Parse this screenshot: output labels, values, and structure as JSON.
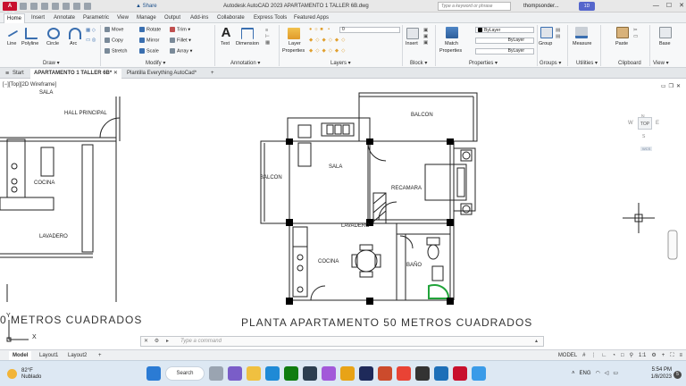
{
  "titlebar": {
    "app_badge": "A CAD",
    "share": "Share",
    "title": "Autodesk AutoCAD 2023    APARTAMENTO 1 TALLER 6B.dwg",
    "search_placeholder": "Type a keyword or phrase",
    "user": "thompsonder...",
    "badge": "1D",
    "min": "—",
    "max": "☐",
    "close": "✕"
  },
  "ribbon_tabs": [
    "Home",
    "Insert",
    "Annotate",
    "Parametric",
    "View",
    "Manage",
    "Output",
    "Add-ins",
    "Collaborate",
    "Express Tools",
    "Featured Apps"
  ],
  "ribbon": {
    "draw": {
      "line": "Line",
      "polyline": "Polyline",
      "circle": "Circle",
      "arc": "Arc",
      "label": "Draw"
    },
    "modify": {
      "move": "Move",
      "rotate": "Rotate",
      "trim": "Trim",
      "copy": "Copy",
      "mirror": "Mirror",
      "fillet": "Fillet",
      "stretch": "Stretch",
      "scale": "Scale",
      "array": "Array",
      "label": "Modify"
    },
    "annotation": {
      "text": "Text",
      "dimension": "Dimension",
      "label": "Annotation"
    },
    "layers": {
      "layer_properties_1": "Layer",
      "layer_properties_2": "Properties",
      "current_layer": "0",
      "label": "Layers"
    },
    "block": {
      "insert": "Insert",
      "label": "Block"
    },
    "properties": {
      "match_1": "Match",
      "match_2": "Properties",
      "color": "ByLayer",
      "linetype": "ByLayer",
      "lineweight": "ByLayer",
      "label": "Properties"
    },
    "groups": {
      "group": "Group",
      "label": "Groups"
    },
    "utilities": {
      "measure": "Measure",
      "label": "Utilities"
    },
    "clipboard": {
      "paste": "Paste",
      "label": "Clipboard"
    },
    "view": {
      "base": "Base",
      "label": "View"
    }
  },
  "doc_tabs": [
    "Start",
    "APARTAMENTO 1 TALLER 6B*",
    "Plantilla Everything AutoCad*"
  ],
  "viewport": {
    "label": "[−][Top][2D Wireframe]",
    "compass": {
      "n": "N",
      "s": "S",
      "e": "E",
      "w": "W",
      "top": "TOP",
      "wcs": "WCS"
    }
  },
  "drawing": {
    "left_plan": {
      "sala": "SALA",
      "hall": "HALL  PRINCIPAL",
      "cocina": "COCINA",
      "lavadero": "LAVADERO",
      "caption": "0  METROS  CUADRADOS"
    },
    "main_plan": {
      "balcon_top": "BALCON",
      "balcon_left": "BALCON",
      "sala": "SALA",
      "recamara": "RECAMARA",
      "lavadero": "LAVADERO",
      "cocina": "COCINA",
      "bano": "BAÑO",
      "caption": "PLANTA  APARTAMENTO  50  METROS  CUADRADOS"
    },
    "axis_y": "Y",
    "axis_x": "X"
  },
  "command": {
    "placeholder": "Type a command"
  },
  "layout_tabs": [
    "Model",
    "Layout1",
    "Layout2"
  ],
  "layout_add": "+",
  "statusbar": {
    "model": "MODEL",
    "scale": "1:1"
  },
  "taskbar": {
    "temp": "82°F",
    "weather": "Nublado",
    "search": "Search",
    "lang": "ENG",
    "time": "5:54 PM",
    "date": "1/8/2023",
    "notifications": "5"
  },
  "colors": {
    "accent_red": "#c8102e",
    "ribbon_bg": "#f7f8f9",
    "taskbar_bg": "#dde8f3"
  }
}
